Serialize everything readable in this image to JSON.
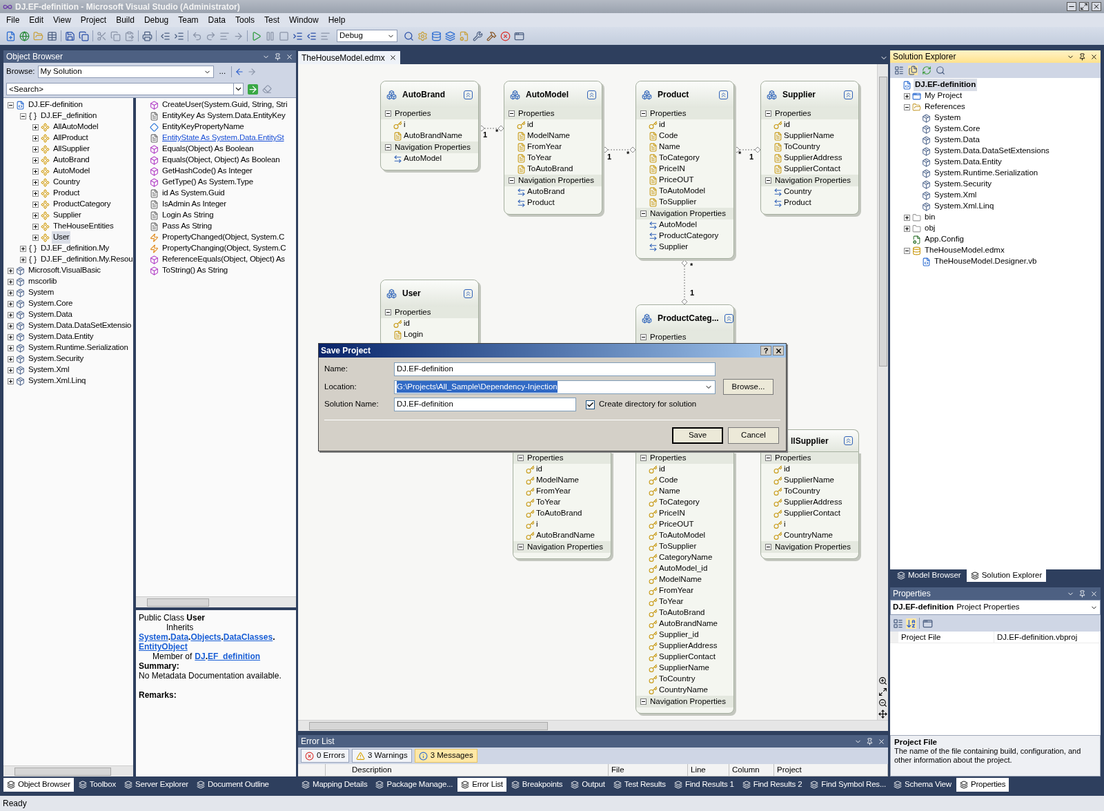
{
  "window": {
    "title": "DJ.EF-definition - Microsoft Visual Studio (Administrator)"
  },
  "menu": [
    "File",
    "Edit",
    "View",
    "Project",
    "Build",
    "Debug",
    "Team",
    "Data",
    "Tools",
    "Test",
    "Window",
    "Help"
  ],
  "toolbar": {
    "configuration": "Debug"
  },
  "object_browser": {
    "title": "Object Browser",
    "browse_label": "Browse:",
    "browse_value": "My Solution",
    "more_button": "...",
    "search": {
      "placeholder": "<Search>"
    },
    "tree": [
      {
        "label": "DJ.EF-definition",
        "kind": "project",
        "expanded": true,
        "selected": false,
        "children": [
          {
            "label": "DJ.EF_definition",
            "kind": "namespace",
            "expanded": true,
            "selected": false,
            "children": [
              {
                "label": "AllAutoModel",
                "kind": "class",
                "expanded": false,
                "selected": false
              },
              {
                "label": "AllProduct",
                "kind": "class",
                "expanded": false,
                "selected": false
              },
              {
                "label": "AllSupplier",
                "kind": "class",
                "expanded": false,
                "selected": false
              },
              {
                "label": "AutoBrand",
                "kind": "class",
                "expanded": false,
                "selected": false
              },
              {
                "label": "AutoModel",
                "kind": "class",
                "expanded": false,
                "selected": false
              },
              {
                "label": "Country",
                "kind": "class",
                "expanded": false,
                "selected": false
              },
              {
                "label": "Product",
                "kind": "class",
                "expanded": false,
                "selected": false
              },
              {
                "label": "ProductCategory",
                "kind": "class",
                "expanded": false,
                "selected": false
              },
              {
                "label": "Supplier",
                "kind": "class",
                "expanded": false,
                "selected": false
              },
              {
                "label": "TheHouseEntities",
                "kind": "class",
                "expanded": false,
                "selected": false
              },
              {
                "label": "User",
                "kind": "class",
                "expanded": false,
                "selected": true
              }
            ]
          },
          {
            "label": "DJ.EF_definition.My",
            "kind": "namespace",
            "expanded": false,
            "selected": false
          },
          {
            "label": "DJ.EF_definition.My.Resou",
            "kind": "namespace",
            "expanded": false,
            "selected": false
          }
        ]
      },
      {
        "label": "Microsoft.VisualBasic",
        "kind": "assembly",
        "expanded": false,
        "selected": false
      },
      {
        "label": "mscorlib",
        "kind": "assembly",
        "expanded": false,
        "selected": false
      },
      {
        "label": "System",
        "kind": "assembly",
        "expanded": false,
        "selected": false
      },
      {
        "label": "System.Core",
        "kind": "assembly",
        "expanded": false,
        "selected": false
      },
      {
        "label": "System.Data",
        "kind": "assembly",
        "expanded": false,
        "selected": false
      },
      {
        "label": "System.Data.DataSetExtensio",
        "kind": "assembly",
        "expanded": false,
        "selected": false
      },
      {
        "label": "System.Data.Entity",
        "kind": "assembly",
        "expanded": false,
        "selected": false
      },
      {
        "label": "System.Runtime.Serialization",
        "kind": "assembly",
        "expanded": false,
        "selected": false
      },
      {
        "label": "System.Security",
        "kind": "assembly",
        "expanded": false,
        "selected": false
      },
      {
        "label": "System.Xml",
        "kind": "assembly",
        "expanded": false,
        "selected": false
      },
      {
        "label": "System.Xml.Linq",
        "kind": "assembly",
        "expanded": false,
        "selected": false
      }
    ],
    "members": [
      {
        "label": "CreateUser(System.Guid, String, Stri",
        "kind": "method",
        "hovered": false
      },
      {
        "label": "EntityKey As System.Data.EntityKey",
        "kind": "property",
        "hovered": false
      },
      {
        "label": "EntityKeyPropertyName",
        "kind": "field",
        "hovered": false
      },
      {
        "label": "EntityState As System.Data.EntitySt",
        "kind": "property",
        "hovered": true
      },
      {
        "label": "Equals(Object) As Boolean",
        "kind": "method",
        "hovered": false
      },
      {
        "label": "Equals(Object, Object) As Boolean",
        "kind": "method",
        "hovered": false
      },
      {
        "label": "GetHashCode() As Integer",
        "kind": "method",
        "hovered": false
      },
      {
        "label": "GetType() As System.Type",
        "kind": "method",
        "hovered": false
      },
      {
        "label": "id As System.Guid",
        "kind": "property",
        "hovered": false
      },
      {
        "label": "IsAdmin As Integer",
        "kind": "property",
        "hovered": false
      },
      {
        "label": "Login As String",
        "kind": "property",
        "hovered": false
      },
      {
        "label": "Pass As String",
        "kind": "property",
        "hovered": false
      },
      {
        "label": "PropertyChanged(Object, System.C",
        "kind": "event",
        "hovered": false
      },
      {
        "label": "PropertyChanging(Object, System.C",
        "kind": "event",
        "hovered": false
      },
      {
        "label": "ReferenceEquals(Object, Object) As",
        "kind": "method",
        "hovered": false
      },
      {
        "label": "ToString() As String",
        "kind": "method",
        "hovered": false
      }
    ],
    "description": {
      "declaration": "Public Class **User**",
      "inherits_label": "Inherits",
      "inherits": [
        {
          "text": "System",
          "link": true
        },
        {
          "text": ".",
          "link": false
        },
        {
          "text": "Data",
          "link": true
        },
        {
          "text": ".",
          "link": false
        },
        {
          "text": "Objects",
          "link": true
        },
        {
          "text": ".",
          "link": false
        },
        {
          "text": "DataClasses",
          "link": true
        },
        {
          "text": ".",
          "link": false
        },
        {
          "text": "EntityObject",
          "link": true
        }
      ],
      "member_label": "Member of",
      "member_of": [
        {
          "text": "DJ",
          "link": true
        },
        {
          "text": ".",
          "link": false
        },
        {
          "text": "EF_definition",
          "link": true
        }
      ],
      "summary_label": "Summary:",
      "summary": "No Metadata Documentation available.",
      "remarks_label": "Remarks:"
    }
  },
  "document_tab": {
    "label": "TheHouseModel.edmx"
  },
  "entities": [
    {
      "kind": "full",
      "title": "AutoBrand",
      "sections": [
        {
          "title": "Properties",
          "rows": [
            {
              "name": "i",
              "kind": "key"
            },
            {
              "name": "AutoBrandName",
              "kind": "scalar"
            }
          ]
        },
        {
          "title": "Navigation Properties",
          "rows": [
            {
              "name": "AutoModel",
              "kind": "navigation"
            }
          ]
        }
      ]
    },
    {
      "kind": "full",
      "title": "AutoModel",
      "sections": [
        {
          "title": "Properties",
          "rows": [
            {
              "name": "id",
              "kind": "key"
            },
            {
              "name": "ModelName",
              "kind": "scalar"
            },
            {
              "name": "FromYear",
              "kind": "scalar"
            },
            {
              "name": "ToYear",
              "kind": "scalar"
            },
            {
              "name": "ToAutoBrand",
              "kind": "scalar"
            }
          ]
        },
        {
          "title": "Navigation Properties",
          "rows": [
            {
              "name": "AutoBrand",
              "kind": "navigation"
            },
            {
              "name": "Product",
              "kind": "navigation"
            }
          ]
        }
      ]
    },
    {
      "kind": "full",
      "title": "Product",
      "sections": [
        {
          "title": "Properties",
          "rows": [
            {
              "name": "id",
              "kind": "key"
            },
            {
              "name": "Code",
              "kind": "scalar"
            },
            {
              "name": "Name",
              "kind": "scalar"
            },
            {
              "name": "ToCategory",
              "kind": "scalar"
            },
            {
              "name": "PriceIN",
              "kind": "scalar"
            },
            {
              "name": "PriceOUT",
              "kind": "scalar"
            },
            {
              "name": "ToAutoModel",
              "kind": "scalar"
            },
            {
              "name": "ToSupplier",
              "kind": "scalar"
            }
          ]
        },
        {
          "title": "Navigation Properties",
          "rows": [
            {
              "name": "AutoModel",
              "kind": "navigation"
            },
            {
              "name": "ProductCategory",
              "kind": "navigation"
            },
            {
              "name": "Supplier",
              "kind": "navigation"
            }
          ]
        }
      ]
    },
    {
      "kind": "full",
      "title": "Supplier",
      "sections": [
        {
          "title": "Properties",
          "rows": [
            {
              "name": "id",
              "kind": "key"
            },
            {
              "name": "SupplierName",
              "kind": "scalar"
            },
            {
              "name": "ToCountry",
              "kind": "scalar"
            },
            {
              "name": "SupplierAddress",
              "kind": "scalar"
            },
            {
              "name": "SupplierContact",
              "kind": "scalar"
            }
          ]
        },
        {
          "title": "Navigation Properties",
          "rows": [
            {
              "name": "Country",
              "kind": "navigation"
            },
            {
              "name": "Product",
              "kind": "navigation"
            }
          ]
        }
      ]
    },
    {
      "kind": "full",
      "title": "User",
      "sections": [
        {
          "title": "Properties",
          "rows": [
            {
              "name": "id",
              "kind": "key"
            },
            {
              "name": "Login",
              "kind": "scalar"
            }
          ]
        }
      ]
    },
    {
      "kind": "full",
      "title": "ProductCateg...",
      "sections": [
        {
          "title": "Properties"
        }
      ]
    },
    {
      "kind": "headless",
      "sections": [
        {
          "title": "Properties",
          "rows": [
            {
              "name": "id",
              "kind": "key"
            },
            {
              "name": "ModelName",
              "kind": "key"
            },
            {
              "name": "FromYear",
              "kind": "key"
            },
            {
              "name": "ToYear",
              "kind": "key"
            },
            {
              "name": "ToAutoBrand",
              "kind": "key"
            },
            {
              "name": "i",
              "kind": "key"
            },
            {
              "name": "AutoBrandName",
              "kind": "key"
            }
          ]
        },
        {
          "title": "Navigation Properties"
        }
      ]
    },
    {
      "kind": "headless",
      "sections": [
        {
          "title": "Properties",
          "rows": [
            {
              "name": "id",
              "kind": "key"
            },
            {
              "name": "Code",
              "kind": "key"
            },
            {
              "name": "Name",
              "kind": "key"
            },
            {
              "name": "ToCategory",
              "kind": "key"
            },
            {
              "name": "PriceIN",
              "kind": "key"
            },
            {
              "name": "PriceOUT",
              "kind": "key"
            },
            {
              "name": "ToAutoModel",
              "kind": "key"
            },
            {
              "name": "ToSupplier",
              "kind": "key"
            },
            {
              "name": "CategoryName",
              "kind": "key"
            },
            {
              "name": "AutoModel_id",
              "kind": "key"
            },
            {
              "name": "ModelName",
              "kind": "key"
            },
            {
              "name": "FromYear",
              "kind": "key"
            },
            {
              "name": "ToYear",
              "kind": "key"
            },
            {
              "name": "ToAutoBrand",
              "kind": "key"
            },
            {
              "name": "AutoBrandName",
              "kind": "key"
            },
            {
              "name": "Supplier_id",
              "kind": "key"
            },
            {
              "name": "SupplierAddress",
              "kind": "key"
            },
            {
              "name": "SupplierContact",
              "kind": "key"
            },
            {
              "name": "SupplierName",
              "kind": "key"
            },
            {
              "name": "ToCountry",
              "kind": "key"
            },
            {
              "name": "CountryName",
              "kind": "key"
            }
          ]
        },
        {
          "title": "Navigation Properties"
        }
      ]
    },
    {
      "kind": "cut-title",
      "title": "llSupplier",
      "sections": [
        {
          "title": "Properties",
          "rows": [
            {
              "name": "id",
              "kind": "key"
            },
            {
              "name": "SupplierName",
              "kind": "key"
            },
            {
              "name": "ToCountry",
              "kind": "key"
            },
            {
              "name": "SupplierAddress",
              "kind": "key"
            },
            {
              "name": "SupplierContact",
              "kind": "key"
            },
            {
              "name": "i",
              "kind": "key"
            },
            {
              "name": "CountryName",
              "kind": "key"
            }
          ]
        },
        {
          "title": "Navigation Properties"
        }
      ]
    }
  ],
  "connectors": [
    {
      "from_label": "1",
      "to_label": "*"
    },
    {
      "from_label": "1",
      "to_label": "*"
    },
    {
      "from_label": "*",
      "to_label": "1"
    },
    {
      "from_label": "*",
      "to_label": "1"
    }
  ],
  "dialog": {
    "title": "Save Project",
    "help_button": "?",
    "fields": [
      {
        "label": "Name:",
        "value": "DJ.EF-definition",
        "kind": "text",
        "text_selected": false
      },
      {
        "label": "Location:",
        "value": "G:\\Projects\\All_Sample\\Dependency-Injection",
        "kind": "combo",
        "text_selected": true
      },
      {
        "label": "Solution Name:",
        "value": "DJ.EF-definition",
        "kind": "short",
        "text_selected": false
      }
    ],
    "browse_button": "Browse...",
    "checkbox": {
      "label": "Create directory for solution",
      "checked": true
    },
    "buttons": [
      {
        "label": "Save",
        "default": true
      },
      {
        "label": "Cancel",
        "default": false
      }
    ]
  },
  "error_list": {
    "title": "Error List",
    "filters": [
      {
        "label": "0 Errors",
        "kind": "error",
        "selected": false
      },
      {
        "label": "3 Warnings",
        "kind": "warning",
        "selected": false
      },
      {
        "label": "3 Messages",
        "kind": "message",
        "selected": true
      }
    ],
    "columns": [
      "Description",
      "File",
      "Line",
      "Column",
      "Project"
    ]
  },
  "solution_explorer": {
    "title": "Solution Explorer",
    "tree": [
      {
        "label": "DJ.EF-definition",
        "kind": "startup-project",
        "selected": true,
        "children": [
          {
            "label": "My Project",
            "kind": "my-project",
            "expanded": false,
            "selected": false
          },
          {
            "label": "References",
            "kind": "folder",
            "expanded": true,
            "selected": false,
            "children": [
              {
                "label": "System",
                "kind": "reference",
                "selected": false
              },
              {
                "label": "System.Core",
                "kind": "reference",
                "selected": false
              },
              {
                "label": "System.Data",
                "kind": "reference",
                "selected": false
              },
              {
                "label": "System.Data.DataSetExtensions",
                "kind": "reference",
                "selected": false
              },
              {
                "label": "System.Data.Entity",
                "kind": "reference",
                "selected": false
              },
              {
                "label": "System.Runtime.Serialization",
                "kind": "reference",
                "selected": false
              },
              {
                "label": "System.Security",
                "kind": "reference",
                "selected": false
              },
              {
                "label": "System.Xml",
                "kind": "reference",
                "selected": false
              },
              {
                "label": "System.Xml.Linq",
                "kind": "reference",
                "selected": false
              }
            ]
          },
          {
            "label": "bin",
            "kind": "hidden-folder",
            "expanded": false,
            "selected": false
          },
          {
            "label": "obj",
            "kind": "hidden-folder",
            "expanded": false,
            "selected": false
          },
          {
            "label": "App.Config",
            "kind": "config",
            "selected": false
          },
          {
            "label": "TheHouseModel.edmx",
            "kind": "edmx",
            "expanded": true,
            "selected": false,
            "children": [
              {
                "label": "TheHouseModel.Designer.vb",
                "kind": "vbfile",
                "selected": false
              }
            ]
          }
        ]
      }
    ],
    "tabs": [
      {
        "label": "Model Browser",
        "selected": false
      },
      {
        "label": "Solution Explorer",
        "selected": true
      }
    ]
  },
  "properties": {
    "title": "Properties",
    "object_name": "DJ.EF-definition",
    "object_type": "Project Properties",
    "rows": [
      {
        "name": "Project File",
        "value": "DJ.EF-definition.vbproj"
      }
    ],
    "help_title": "Project File",
    "help_text": "The name of the file containing build, configuration, and other information about the project."
  },
  "tool_tabs": {
    "left": [
      {
        "label": "Object Browser",
        "selected": true
      },
      {
        "label": "Toolbox",
        "selected": false
      },
      {
        "label": "Server Explorer",
        "selected": false
      },
      {
        "label": "Document Outline",
        "selected": false
      }
    ],
    "center": [
      {
        "label": "Mapping Details",
        "selected": false
      },
      {
        "label": "Package Manage...",
        "selected": false
      },
      {
        "label": "Error List",
        "selected": true
      },
      {
        "label": "Breakpoints",
        "selected": false
      },
      {
        "label": "Output",
        "selected": false
      },
      {
        "label": "Test Results",
        "selected": false
      },
      {
        "label": "Find Results 1",
        "selected": false
      },
      {
        "label": "Find Results 2",
        "selected": false
      },
      {
        "label": "Find Symbol Res...",
        "selected": false
      }
    ],
    "right": [
      {
        "label": "Schema View",
        "selected": false
      },
      {
        "label": "Properties",
        "selected": true
      }
    ]
  },
  "status_bar": {
    "text": "Ready"
  }
}
